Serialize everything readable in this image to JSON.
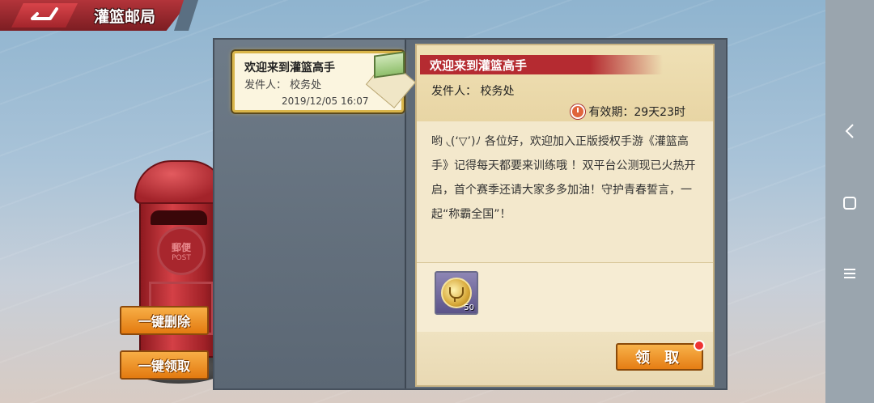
{
  "header": {
    "title": "灌篮邮局",
    "back_icon": "back-arrow-icon"
  },
  "mail_list": [
    {
      "title": "欢迎来到灌篮高手",
      "sender": "发件人： 校务处",
      "date": "2019/12/05 16:07",
      "icon": "envelope-icon"
    }
  ],
  "mail_detail": {
    "title": "欢迎来到灌篮高手",
    "sender": "发件人： 校务处",
    "validity": "有效期：29天23时",
    "body": "哟 ◟(‘▽’)ﾉ 各位好，欢迎加入正版授权手游《灌篮高手》记得每天都要来训练哦 ！双平台公测现已火热开启，首个赛季还请大家多多加油！守护青春誓言，一起“称霸全国”！",
    "attachments": [
      {
        "icon": "trophy-coin-icon",
        "quantity": "50"
      }
    ],
    "claim_label": "领 取"
  },
  "mailbox": {
    "emblem_text": "郵便",
    "emblem_sub": "POST"
  },
  "actions": {
    "delete_all": "一键删除",
    "claim_all": "一键领取"
  },
  "colors": {
    "accent_red": "#b52b31",
    "button_orange": "#e57d14",
    "highlight_gold": "#d9b54a"
  }
}
